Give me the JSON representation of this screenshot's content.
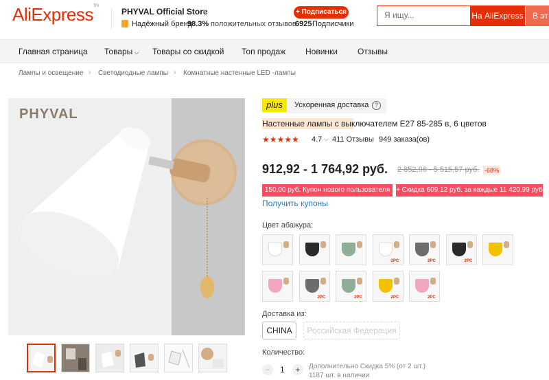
{
  "header": {
    "logo": "AliExpress",
    "store_name": "PHYVAL Official Store",
    "trusted_label": "Надёжный бренд",
    "positive_pct": "98.3%",
    "positive_label": "положительных отзывов",
    "subscribe_label": "+ Подписаться",
    "followers_count": "6925",
    "followers_label": "Подписчики",
    "search_placeholder": "Я ищу...",
    "search_btn_ali": "На AliExpress",
    "search_btn_store": "В эт"
  },
  "nav": {
    "items": [
      "Главная страница",
      "Товары",
      "Товары со скидкой",
      "Топ продаж",
      "Новинки",
      "Отзывы"
    ]
  },
  "breadcrumb": [
    "Лампы и освещение",
    "Светодиодные лампы",
    "Комнатные настенные LED -лампы"
  ],
  "image": {
    "watermark": "PHYVAL"
  },
  "product": {
    "plus_badge": "plus",
    "delivery_label": "Ускоренная доставка",
    "help_icon": "?",
    "title": "Настенные лампы с выключателем E27 85-285 в, 6 цветов",
    "rating": "4.7",
    "reviews": "411 Отзывы",
    "orders": "949 заказа(ов)",
    "price": "912,92 - 1 764,92 руб.",
    "old_price": "2 852,96 - 5 515,57 руб.",
    "discount": "-68%",
    "coupon_new_user": "150,00 руб. Купон нового пользователя",
    "coupon_discount": "+ Скидка 609,12 руб. за каждые 11 420,99 руб.",
    "get_coupons": "Получить купоны",
    "color_label": "Цвет абажура:",
    "swatches": [
      {
        "color": "#ffffff",
        "tag": ""
      },
      {
        "color": "#2a2a2a",
        "tag": ""
      },
      {
        "color": "#8fae9a",
        "tag": ""
      },
      {
        "color": "#ffffff",
        "tag": "2PC"
      },
      {
        "color": "#6d6d6d",
        "tag": "2PC"
      },
      {
        "color": "#2a2a2a",
        "tag": "2PC"
      },
      {
        "color": "#f2c200",
        "tag": ""
      },
      {
        "color": "#f1a7c1",
        "tag": ""
      },
      {
        "color": "#6d6d6d",
        "tag": "2PC"
      },
      {
        "color": "#8fae9a",
        "tag": "2PC"
      },
      {
        "color": "#f2c200",
        "tag": "2PC"
      },
      {
        "color": "#f1a7c1",
        "tag": "2PC"
      }
    ],
    "ship_from_label": "Доставка из:",
    "ship_options": [
      "CHINA",
      "Российская Федерация"
    ],
    "qty_label": "Количество:",
    "qty_minus": "−",
    "qty_value": "1",
    "qty_plus": "+",
    "qty_extra": "Дополнительно Скидка 5% (от 2 шт.)",
    "qty_stock": "1187 шт. в наличии"
  },
  "colors": {
    "brand": "#e62e04",
    "coupon": "#fb4b60",
    "link": "#2a7bbd",
    "plus": "#f6e800"
  }
}
